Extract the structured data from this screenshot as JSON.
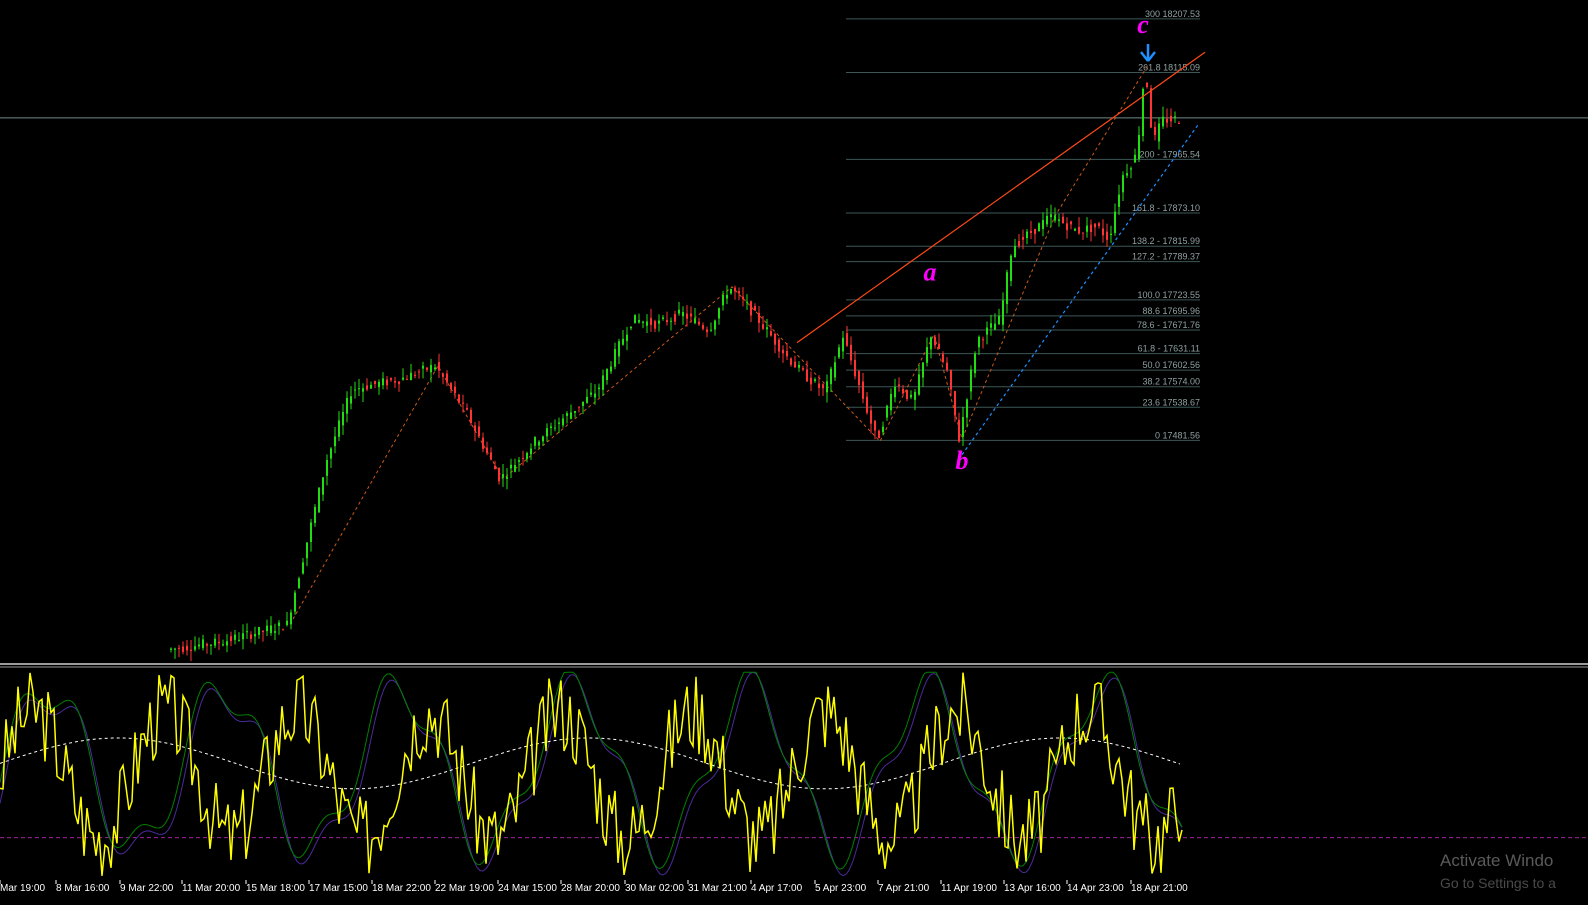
{
  "chart_data": {
    "type": "candlestick",
    "main_panel": {
      "y_axis": "price",
      "price_range": [
        17100,
        18240
      ],
      "horizontal_line_level": 18037,
      "candle_colors": {
        "up": "#22dd11",
        "down": "#ff3333"
      },
      "fibonacci_levels": [
        {
          "label": "300 18207.53",
          "value": 18207.53
        },
        {
          "label": "261.8 18115.09",
          "value": 18115.09
        },
        {
          "label": "200 - 17965.54",
          "value": 17965.54
        },
        {
          "label": "161.8 - 17873.10",
          "value": 17873.1
        },
        {
          "label": "138.2 - 17815.99",
          "value": 17815.99
        },
        {
          "label": "127.2 - 17789.37",
          "value": 17789.37
        },
        {
          "label": "100.0 17723.55",
          "value": 17723.55
        },
        {
          "label": "88.6 17695.96",
          "value": 17695.96
        },
        {
          "label": "78.6 - 17671.76",
          "value": 17671.76
        },
        {
          "label": "61.8 - 17631.11",
          "value": 17631.11
        },
        {
          "label": "50.0 17602.56",
          "value": 17602.56
        },
        {
          "label": "38.2 17574.00",
          "value": 17574.0
        },
        {
          "label": "23.6 17538.67",
          "value": 17538.67
        },
        {
          "label": "0 17481.56",
          "value": 17481.56
        }
      ],
      "wave_labels": [
        {
          "text": "a",
          "price": 17757
        },
        {
          "text": "b",
          "price": 17432
        },
        {
          "text": "c",
          "price": 18183
        }
      ]
    },
    "x_labels": [
      "Mar 19:00",
      "8 Mar 16:00",
      "9 Mar 22:00",
      "11 Mar 20:00",
      "15 Mar 18:00",
      "17 Mar 15:00",
      "18 Mar 22:00",
      "22 Mar 19:00",
      "24 Mar 15:00",
      "28 Mar 20:00",
      "30 Mar 02:00",
      "31 Mar 21:00",
      "4 Apr 17:00",
      "5 Apr 23:00",
      "7 Apr 21:00",
      "11 Apr 19:00",
      "13 Apr 16:00",
      "14 Apr 23:00",
      "18 Apr 21:00"
    ],
    "oscillator": {
      "range": [
        0,
        100
      ],
      "reference_level": 20,
      "series": [
        {
          "color": "#ffff00"
        },
        {
          "color": "#ffffff",
          "dashed": true
        },
        {
          "color": "#008000"
        },
        {
          "color": "#4b2a9a"
        }
      ]
    }
  },
  "watermark": {
    "line1": "Activate Windo",
    "line2": "Go to Settings to a"
  }
}
